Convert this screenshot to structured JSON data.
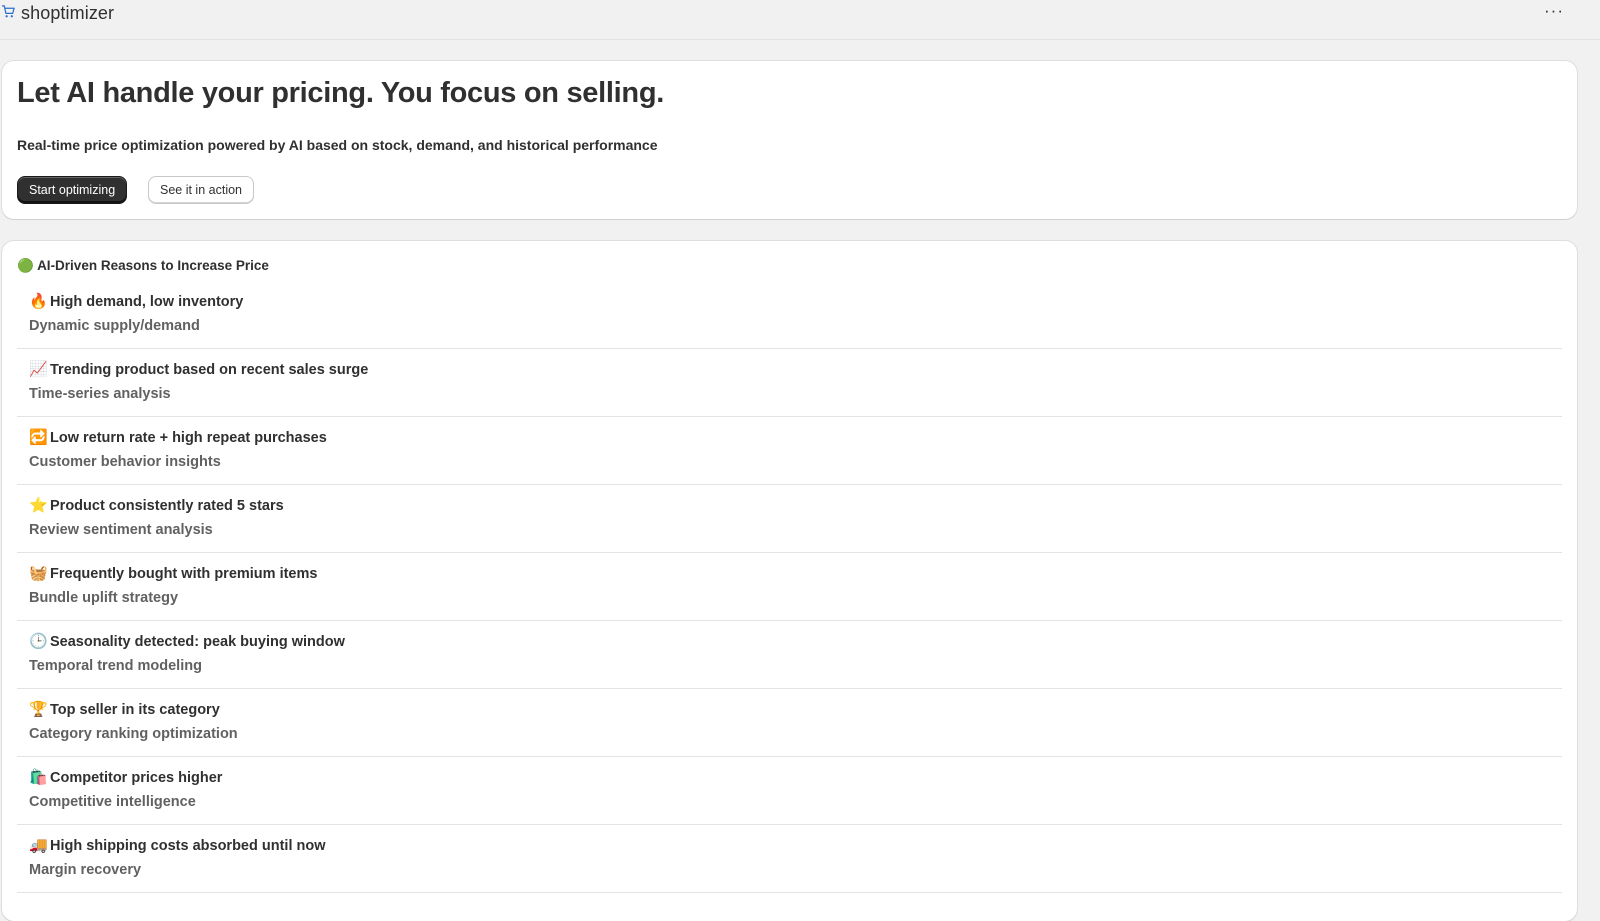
{
  "app": {
    "name": "shoptimizer",
    "logo_icon": "shopping-cart-icon",
    "more_icon": "ellipsis-icon",
    "more_label": "···"
  },
  "hero": {
    "title": "Let AI handle your pricing. You focus on selling.",
    "subtitle": "Real-time price optimization powered by AI based on stock, demand, and historical performance",
    "primary_button": "Start optimizing",
    "secondary_button": "See it in action"
  },
  "reasons": {
    "heading_emoji": "🟢",
    "heading": "AI-Driven Reasons to Increase Price",
    "items": [
      {
        "emoji": "🔥",
        "title": "High demand, low inventory",
        "subtitle": "Dynamic supply/demand"
      },
      {
        "emoji": "📈",
        "title": "Trending product based on recent sales surge",
        "subtitle": "Time-series analysis"
      },
      {
        "emoji": "🔁",
        "title": "Low return rate + high repeat purchases",
        "subtitle": "Customer behavior insights"
      },
      {
        "emoji": "⭐",
        "title": "Product consistently rated 5 stars",
        "subtitle": "Review sentiment analysis"
      },
      {
        "emoji": "🧺",
        "title": "Frequently bought with premium items",
        "subtitle": "Bundle uplift strategy"
      },
      {
        "emoji": "🕒",
        "title": "Seasonality detected: peak buying window",
        "subtitle": "Temporal trend modeling"
      },
      {
        "emoji": "🏆",
        "title": "Top seller in its category",
        "subtitle": "Category ranking optimization"
      },
      {
        "emoji": "🛍️",
        "title": "Competitor prices higher",
        "subtitle": "Competitive intelligence"
      },
      {
        "emoji": "🚚",
        "title": "High shipping costs absorbed until now",
        "subtitle": "Margin recovery"
      }
    ]
  }
}
